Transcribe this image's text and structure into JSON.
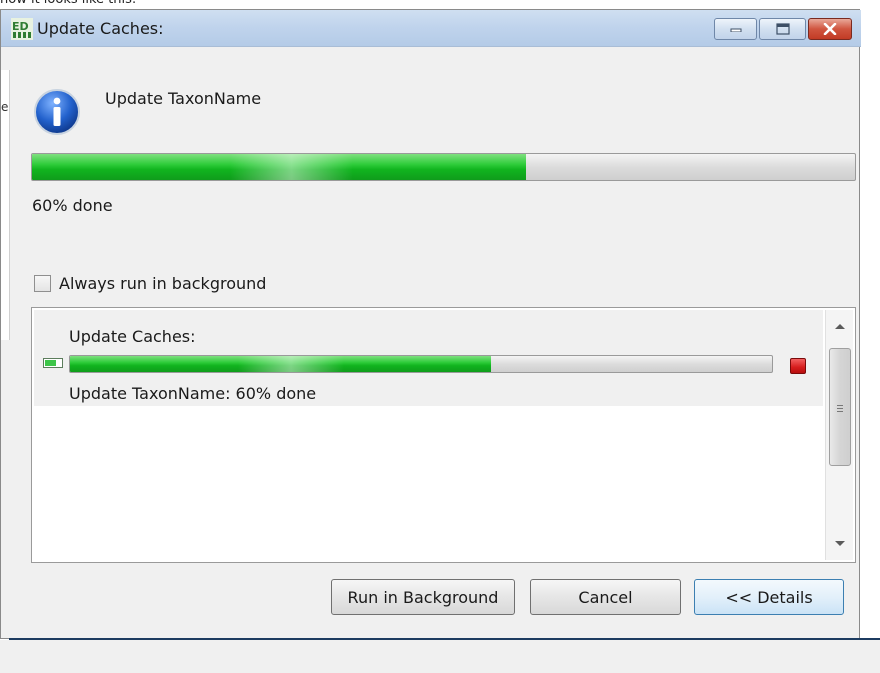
{
  "caption": "now it looks like this:",
  "window": {
    "title": "Update Caches:",
    "app_icon": "ed-app-icon",
    "controls": [
      "minimize-icon",
      "maximize-icon",
      "close-icon"
    ]
  },
  "left_clip_char": "e",
  "task": {
    "icon": "info-icon",
    "title": "Update TaxonName",
    "progress": 0.6,
    "percent_label": "60% done"
  },
  "always_background": {
    "label": "Always run in background",
    "checked": false
  },
  "details": {
    "job_name": "Update Caches:",
    "job_progress": 0.6,
    "job_status": "Update TaxonName:  60% done",
    "stop_icon": "stop-icon"
  },
  "buttons": {
    "run_background": "Run in Background",
    "cancel": "Cancel",
    "details": "<< Details"
  },
  "colors": {
    "progress_green": "#1fbf2b",
    "title_bar": "#bfd3ec",
    "close_red": "#c94230",
    "stop_red": "#d61c1c"
  }
}
